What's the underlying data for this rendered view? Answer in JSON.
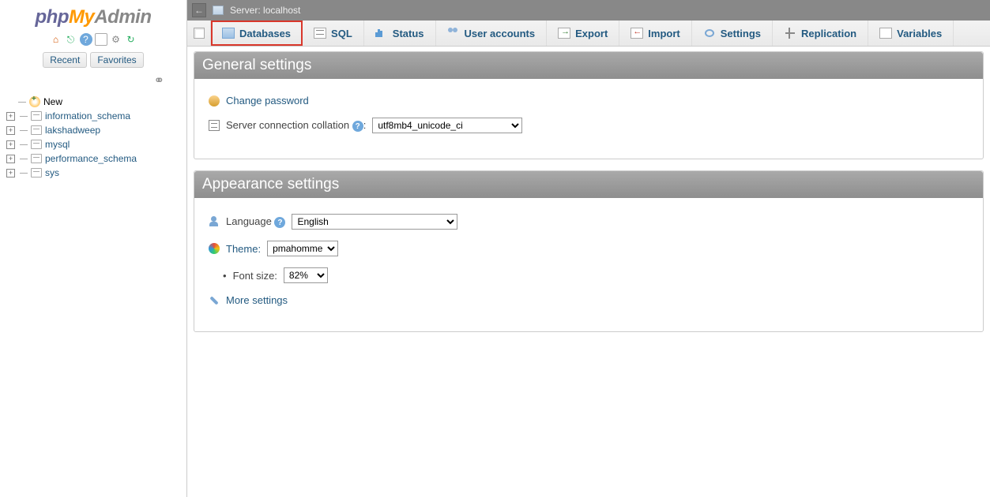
{
  "logo": {
    "p1": "php",
    "p2": "My",
    "p3": "Admin"
  },
  "sidebar_tabs": {
    "recent": "Recent",
    "favorites": "Favorites"
  },
  "link_symbol": "⚭",
  "tree": {
    "new_label": "New",
    "items": [
      "information_schema",
      "lakshadweep",
      "mysql",
      "performance_schema",
      "sys"
    ]
  },
  "breadcrumb": {
    "server_label": "Server:",
    "server_name": "localhost"
  },
  "nav": {
    "databases": "Databases",
    "sql": "SQL",
    "status": "Status",
    "users": "User accounts",
    "export": "Export",
    "import": "Import",
    "settings": "Settings",
    "replication": "Replication",
    "variables": "Variables"
  },
  "general": {
    "title": "General settings",
    "change_pw": "Change password",
    "collation_label": "Server connection collation",
    "collation_value": "utf8mb4_unicode_ci"
  },
  "appearance": {
    "title": "Appearance settings",
    "language_label": "Language",
    "language_value": "English",
    "theme_label": "Theme:",
    "theme_value": "pmahomme",
    "fontsize_label": "Font size:",
    "fontsize_value": "82%",
    "more": "More settings"
  }
}
